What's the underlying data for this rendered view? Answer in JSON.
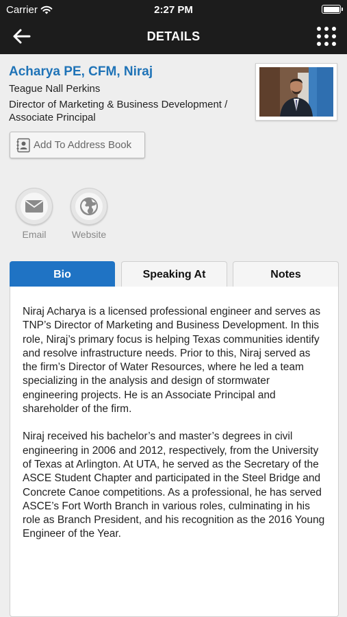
{
  "status_bar": {
    "carrier": "Carrier",
    "time": "2:27 PM"
  },
  "nav": {
    "title": "DETAILS",
    "back_icon": "arrow-left-icon",
    "menu_icon": "grid-dots-icon"
  },
  "profile": {
    "name": "Acharya PE, CFM, Niraj",
    "company": "Teague Nall Perkins",
    "title": "Director of Marketing & Business Development / Associate Principal",
    "add_to_address_book": "Add To Address Book"
  },
  "contact_actions": [
    {
      "label": "Email",
      "icon": "envelope-icon"
    },
    {
      "label": "Website",
      "icon": "globe-icon"
    }
  ],
  "tabs": [
    {
      "label": "Bio",
      "active": true
    },
    {
      "label": "Speaking At",
      "active": false
    },
    {
      "label": "Notes",
      "active": false
    }
  ],
  "bio": {
    "paragraphs": [
      "Niraj Acharya is a licensed professional engineer and serves as TNP’s Director of Marketing and Business Development.  In this role, Niraj’s primary focus is helping Texas communities identify and resolve infrastructure needs.  Prior to this, Niraj served as the firm’s Director of Water Resources, where he led a team specializing in the analysis and design of stormwater engineering projects.  He is an Associate Principal and shareholder of the firm.",
      "Niraj received his bachelor’s and master’s degrees in civil engineering in 2006 and 2012, respectively, from the University of Texas at Arlington.  At UTA, he served as the Secretary of the ASCE Student Chapter and participated in the Steel Bridge and Concrete Canoe competitions.  As a professional, he has served ASCE’s Fort Worth Branch in various roles, culminating in his role as Branch President, and his recognition as the 2016 Young Engineer of the Year."
    ]
  },
  "colors": {
    "header_bg": "#1c1c1c",
    "accent": "#1f73c4",
    "name_color": "#1f73b7",
    "page_bg": "#eeeeee"
  }
}
